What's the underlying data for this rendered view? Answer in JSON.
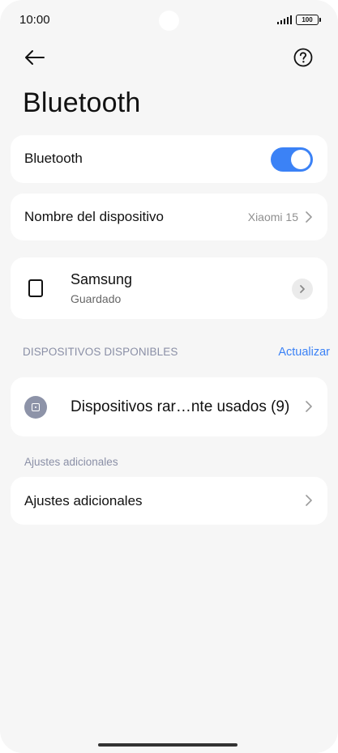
{
  "status_bar": {
    "time": "10:00",
    "battery": "100"
  },
  "header": {
    "back_icon": "arrow-left-icon",
    "help_icon": "question-circle-icon",
    "title": "Bluetooth"
  },
  "bluetooth_toggle": {
    "label": "Bluetooth",
    "enabled": true,
    "accent_color": "#3b82f6"
  },
  "device_name_row": {
    "label": "Nombre del dispositivo",
    "value": "Xiaomi 15"
  },
  "paired_device": {
    "name": "Samsung",
    "status": "Guardado",
    "icon": "phone-outline-icon"
  },
  "available_section": {
    "header": "DISPOSITIVOS DISPONIBLES",
    "refresh_label": "Actualizar",
    "rare_devices_label": "Dispositivos rar…nte usados (9)",
    "rare_devices_icon": "device-circle-icon"
  },
  "additional": {
    "header": "Ajustes adicionales",
    "row_label": "Ajustes adicionales"
  }
}
